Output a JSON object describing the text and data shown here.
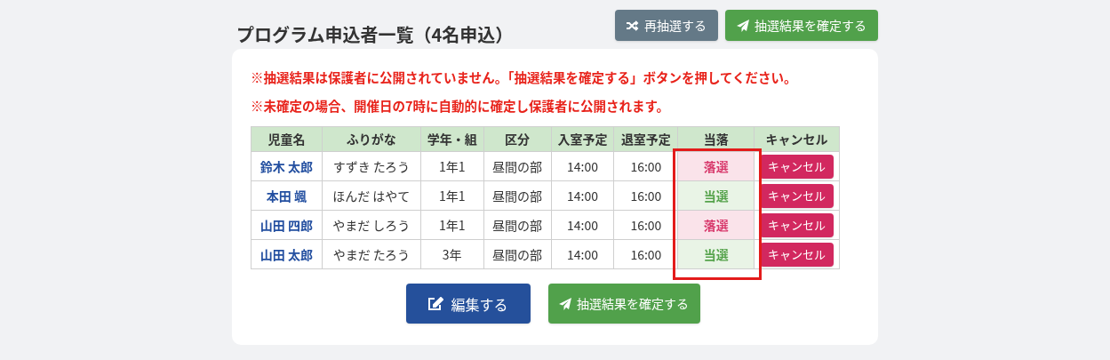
{
  "title": "プログラム申込者一覧（4名申込）",
  "header_buttons": [
    {
      "kind": "shuffle",
      "label": "再抽選する"
    },
    {
      "kind": "send",
      "label": "抽選結果を確定する"
    }
  ],
  "notices": [
    "※抽選結果は保護者に公開されていません。「抽選結果を確定する」ボタンを押してください。",
    "※未確定の場合、開催日の7時に自動的に確定し保護者に公開されます。"
  ],
  "table": {
    "columns": [
      "児童名",
      "ふりがな",
      "学年・組",
      "区分",
      "入室予定",
      "退室予定",
      "当落",
      "キャンセル"
    ],
    "rows": [
      {
        "name": "鈴木 太郎",
        "furigana": "すずき たろう",
        "grade": "1年1",
        "section": "昼間の部",
        "in": "14:00",
        "out": "16:00",
        "result": {
          "text": "落選",
          "won": false
        },
        "cancel": "キャンセル"
      },
      {
        "name": "本田 颯",
        "furigana": "ほんだ はやて",
        "grade": "1年1",
        "section": "昼間の部",
        "in": "14:00",
        "out": "16:00",
        "result": {
          "text": "当選",
          "won": true
        },
        "cancel": "キャンセル"
      },
      {
        "name": "山田 四郎",
        "furigana": "やまだ しろう",
        "grade": "1年1",
        "section": "昼間の部",
        "in": "14:00",
        "out": "16:00",
        "result": {
          "text": "落選",
          "won": false
        },
        "cancel": "キャンセル"
      },
      {
        "name": "山田 太郎",
        "furigana": "やまだ たろう",
        "grade": "3年",
        "section": "昼間の部",
        "in": "14:00",
        "out": "16:00",
        "result": {
          "text": "当選",
          "won": true
        },
        "cancel": "キャンセル"
      }
    ]
  },
  "highlight": {
    "shown": true
  },
  "footer_buttons": [
    {
      "kind": "edit",
      "label": "編集する"
    },
    {
      "kind": "send",
      "label": "抽選結果を確定する"
    }
  ]
}
